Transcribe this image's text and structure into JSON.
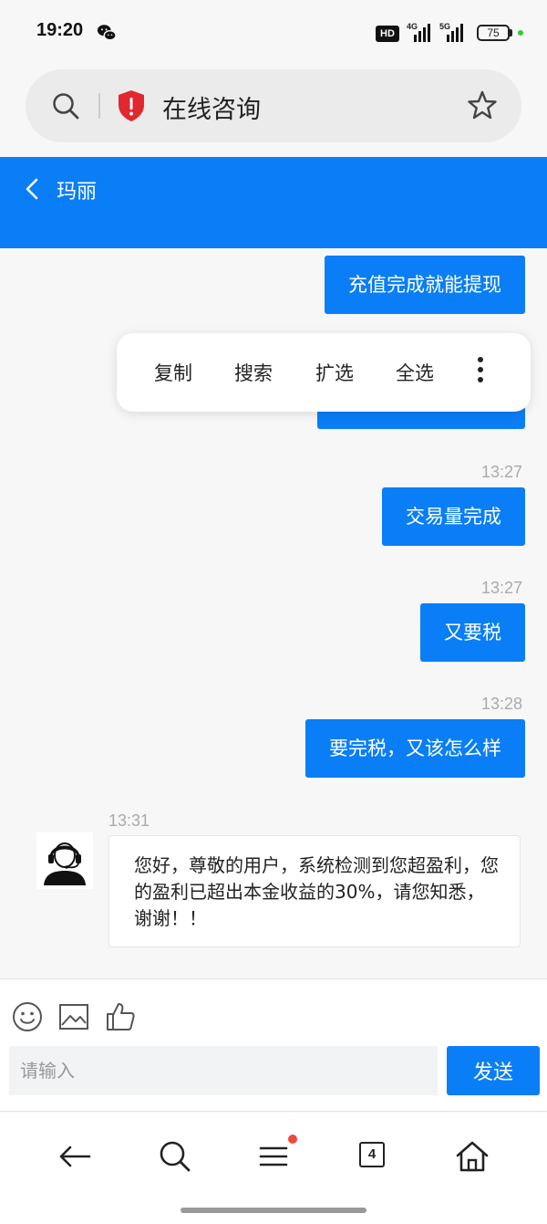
{
  "status_bar": {
    "time": "19:20",
    "hd_label": "HD",
    "signal_1_label": "4G",
    "signal_2_label": "5G",
    "battery": "75"
  },
  "address_bar": {
    "title": "在线咨询",
    "icons": [
      "search-icon",
      "shield-alert-icon",
      "star-icon"
    ]
  },
  "chat": {
    "contact_name": "玛丽",
    "header_color": "#0a7ef6",
    "context_menu": {
      "items": [
        "复制",
        "搜索",
        "扩选",
        "全选"
      ]
    },
    "messages": [
      {
        "side": "right",
        "time": "",
        "text": "充值完成就能提现"
      },
      {
        "side": "right",
        "time": "",
        "text": ""
      },
      {
        "side": "right",
        "time": "13:27",
        "text": "交易量完成"
      },
      {
        "side": "right",
        "time": "13:27",
        "text": "又要税"
      },
      {
        "side": "right",
        "time": "13:28",
        "text": "要完税，又该怎么样"
      },
      {
        "side": "left",
        "time": "13:31",
        "text": "您好，尊敬的用户，系统检测到您超盈利，您的盈利已超出本金收益的30%，请您知悉，谢谢！！"
      }
    ]
  },
  "composer": {
    "placeholder": "请输入",
    "send_label": "发送",
    "icons": [
      "emoji-icon",
      "image-icon",
      "thumbs-up-icon"
    ]
  },
  "browser_nav": {
    "tabs_count": "4",
    "icons": [
      "back-arrow-icon",
      "search-icon",
      "menu-icon",
      "tabs-icon",
      "home-icon"
    ]
  }
}
